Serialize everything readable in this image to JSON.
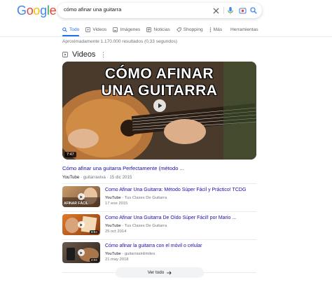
{
  "logo": [
    "G",
    "o",
    "o",
    "g",
    "l",
    "e"
  ],
  "search": {
    "query": "cómo afinar una guitarra"
  },
  "tabs": [
    {
      "label": "Todo",
      "icon": "search-icon",
      "active": true
    },
    {
      "label": "Videos",
      "icon": "video-icon",
      "active": false
    },
    {
      "label": "Imágenes",
      "icon": "image-icon",
      "active": false
    },
    {
      "label": "Noticias",
      "icon": "news-icon",
      "active": false
    },
    {
      "label": "Shopping",
      "icon": "tag-icon",
      "active": false
    },
    {
      "label": "Más",
      "icon": "more-vert-icon",
      "active": false
    }
  ],
  "tools_label": "Herramientas",
  "result_stats": "Aproximadamente 1.170.000 resultados (0,33 segundos)",
  "videos_section": {
    "title": "Videos",
    "featured": {
      "thumb_line1": "CÓMO AFINAR",
      "thumb_line2": "UNA GUITARRA",
      "duration": "7:47",
      "title": "Cómo afinar una guitarra Perfectamente (método ...",
      "source": "YouTube",
      "channel": "guitarraviva",
      "date": "15 dic 2015"
    },
    "items": [
      {
        "title": "Como Afinar Una Guitarra: Método Súper Fácil y Práctico! TCDG",
        "source": "YouTube",
        "channel": "Tus Clases De Guitarra",
        "date": "17 ene 2015",
        "thumb_caption": "AFINAR FÁCIL",
        "duration": ""
      },
      {
        "title": "Como Afinar Una Guitarra De Oído Súper Fácil! por Mario ...",
        "source": "YouTube",
        "channel": "Tus Clases De Guitarra",
        "date": "25 oct 2014",
        "thumb_caption": "",
        "duration": "6:54"
      },
      {
        "title": "Cómo afinar la guitarra con el móvil o celular",
        "source": "YouTube",
        "channel": "guitarrasinlimites",
        "date": "21 may 2018",
        "thumb_caption": "",
        "duration": "4:04"
      }
    ],
    "see_all": "Ver todo"
  },
  "colors": {
    "link": "#1a0dab",
    "accent": "#1a73e8",
    "muted": "#70757a"
  }
}
